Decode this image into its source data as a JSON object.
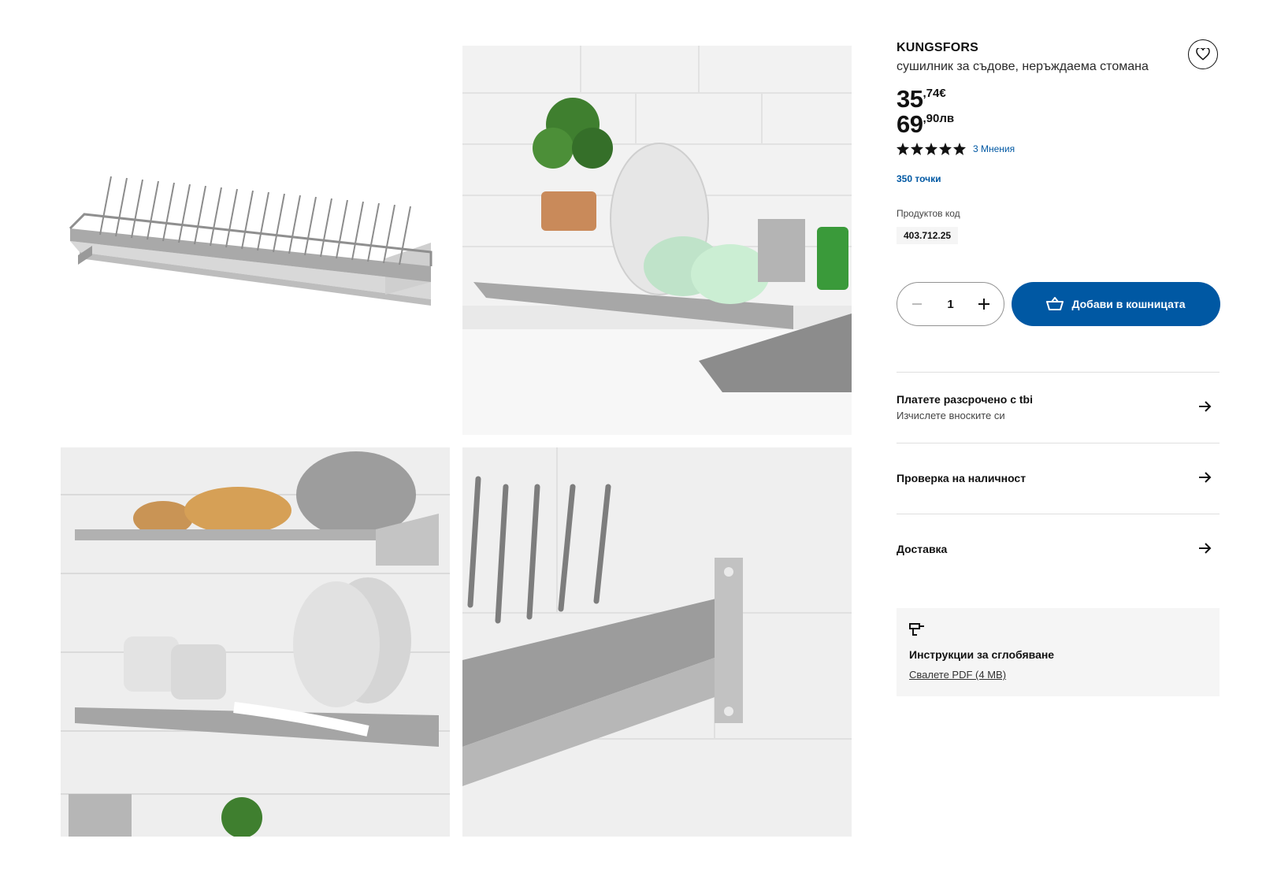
{
  "product": {
    "name": "KUNGSFORS",
    "description": "сушилник за съдове, неръждаема стомана",
    "price_eur_int": "35",
    "price_eur_dec": ",74€",
    "price_bgn_int": "69",
    "price_bgn_dec": ",90лв",
    "rating": 5,
    "reviews_label": "3 Мнения",
    "points_label": "350 точки",
    "code_label": "Продуктов код",
    "code": "403.712.25"
  },
  "cart": {
    "quantity": "1",
    "add_label": "Добави в кошницата"
  },
  "rows": [
    {
      "title": "Платете разсрочено с tbi",
      "subtitle": "Изчислете вноските си"
    },
    {
      "title": "Проверка на наличност"
    },
    {
      "title": "Доставка"
    }
  ],
  "assembly": {
    "title": "Инструкции за сглобяване",
    "link": "Свалете PDF (4 MB)"
  },
  "gallery": {
    "images": [
      "product-image-rack",
      "product-image-kitchen-counter",
      "product-image-wall-shelves",
      "product-image-closeup"
    ]
  },
  "colors": {
    "accent_blue": "#0058a3",
    "text": "#111111",
    "panel_bg": "#f5f5f5"
  }
}
